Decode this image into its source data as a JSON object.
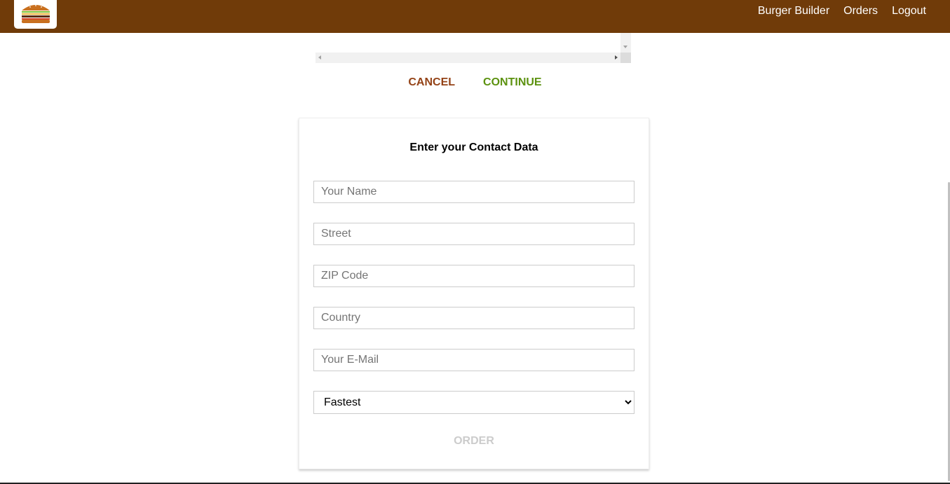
{
  "toolbar": {
    "logo_alt": "burger-logo",
    "nav": [
      {
        "label": "Burger Builder"
      },
      {
        "label": "Orders"
      },
      {
        "label": "Logout"
      }
    ],
    "background_color": "#703b09"
  },
  "summary": {
    "cancel_label": "CANCEL",
    "continue_label": "CONTINUE",
    "cancel_color": "#944317",
    "continue_color": "#5c9210"
  },
  "contact": {
    "title": "Enter your Contact Data",
    "fields": {
      "name_placeholder": "Your Name",
      "street_placeholder": "Street",
      "zip_placeholder": "ZIP Code",
      "country_placeholder": "Country",
      "email_placeholder": "Your E-Mail"
    },
    "delivery_method": {
      "selected": "Fastest"
    },
    "order_label": "ORDER"
  }
}
